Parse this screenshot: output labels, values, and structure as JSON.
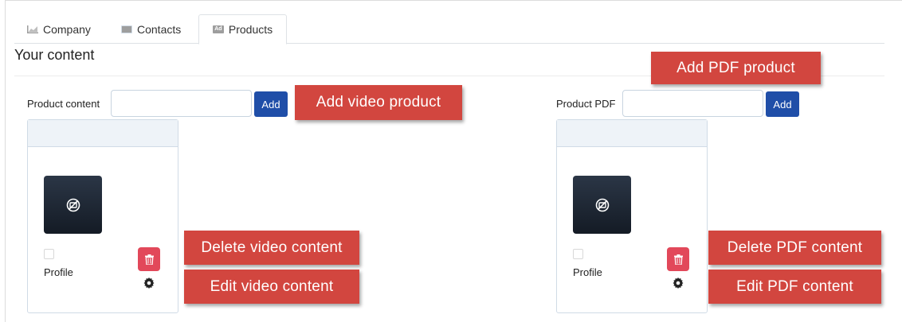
{
  "tabs": [
    {
      "label": "Company",
      "icon": "line-chart-icon",
      "active": false
    },
    {
      "label": "Contacts",
      "icon": "id-card-icon",
      "active": false
    },
    {
      "label": "Products",
      "icon": "ad-icon",
      "active": true
    }
  ],
  "page_title": "Your content",
  "video_section": {
    "field_label": "Product content",
    "input_value": "",
    "add_label": "Add",
    "card": {
      "item_label": "Profile"
    }
  },
  "pdf_section": {
    "field_label": "Product PDF",
    "input_value": "",
    "add_label": "Add",
    "card": {
      "item_label": "Profile"
    }
  },
  "callouts": {
    "add_video": "Add video product",
    "add_pdf": "Add PDF product",
    "delete_video": "Delete video content",
    "edit_video": "Edit video content",
    "delete_pdf": "Delete PDF content",
    "edit_pdf": "Edit PDF content"
  },
  "colors": {
    "accent_button": "#1f4ea8",
    "delete_button": "#e2485a",
    "callout_bg": "#d2463f",
    "thumbnail_bg": "#1b2330"
  }
}
